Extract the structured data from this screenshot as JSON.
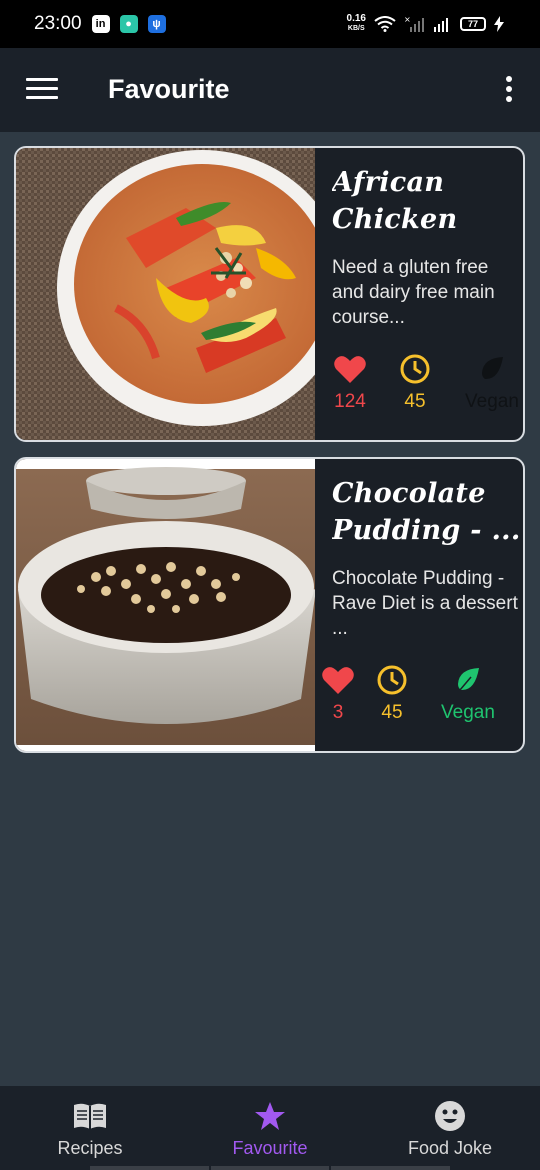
{
  "status_bar": {
    "time": "23:00",
    "net_speed": "0.16",
    "net_unit": "KB/S",
    "battery": "77"
  },
  "app_bar": {
    "title": "Favourite",
    "menu_icon": "hamburger-menu-icon",
    "more_icon": "more-vert-icon"
  },
  "recipes": [
    {
      "title": "African Chicken Pe...",
      "description": "Need a gluten free and dairy free main course...",
      "likes": "124",
      "minutes": "45",
      "vegan_label": "Vegan",
      "vegan": false
    },
    {
      "title": "Chocolate Pudding - ...",
      "description": "Chocolate Pudding - Rave Diet is a dessert ...",
      "likes": "3",
      "minutes": "45",
      "vegan_label": "Vegan",
      "vegan": true
    }
  ],
  "bottom_nav": {
    "items": [
      {
        "label": "Recipes",
        "icon": "book-icon"
      },
      {
        "label": "Favourite",
        "icon": "star-icon"
      },
      {
        "label": "Food Joke",
        "icon": "smiley-icon"
      }
    ],
    "active_index": 1
  },
  "colors": {
    "accent": "#a259f0",
    "heart": "#f0474b",
    "clock": "#f6c02c",
    "vegan": "#1fc46f",
    "surface": "#1b2129",
    "background": "#2f3a44"
  }
}
